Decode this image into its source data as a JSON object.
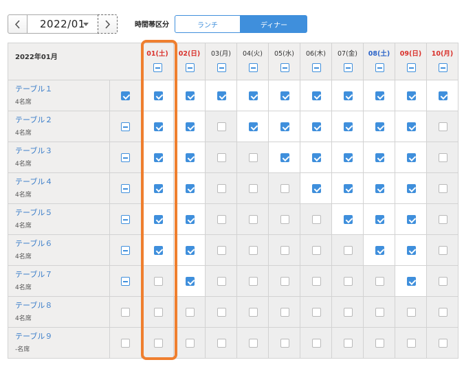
{
  "toolbar": {
    "month": "2022/01",
    "timezone_label": "時間帯区分",
    "segments": [
      "ランチ",
      "ディナー"
    ],
    "selected_segment": "ディナー"
  },
  "grid_header": "2022年01月",
  "dates": [
    {
      "label": "01(土)",
      "kind": "hol",
      "bold": true
    },
    {
      "label": "02(日)",
      "kind": "sun",
      "bold": true
    },
    {
      "label": "03(月)",
      "kind": "normal",
      "bold": false
    },
    {
      "label": "04(火)",
      "kind": "normal",
      "bold": false
    },
    {
      "label": "05(水)",
      "kind": "normal",
      "bold": false
    },
    {
      "label": "06(木)",
      "kind": "normal",
      "bold": false
    },
    {
      "label": "07(金)",
      "kind": "normal",
      "bold": false
    },
    {
      "label": "08(土)",
      "kind": "sat",
      "bold": true
    },
    {
      "label": "09(日)",
      "kind": "sun",
      "bold": true
    },
    {
      "label": "10(月)",
      "kind": "hol",
      "bold": true
    }
  ],
  "tables": [
    {
      "name": "テーブル１",
      "capacity": "4名席",
      "row_state": "on",
      "days": [
        1,
        1,
        1,
        1,
        1,
        1,
        1,
        1,
        1,
        1
      ]
    },
    {
      "name": "テーブル２",
      "capacity": "4名席",
      "row_state": "mixed",
      "days": [
        1,
        1,
        0,
        1,
        1,
        1,
        1,
        1,
        1,
        0
      ]
    },
    {
      "name": "テーブル３",
      "capacity": "4名席",
      "row_state": "mixed",
      "days": [
        1,
        1,
        0,
        0,
        1,
        1,
        1,
        1,
        1,
        0
      ]
    },
    {
      "name": "テーブル４",
      "capacity": "4名席",
      "row_state": "mixed",
      "days": [
        1,
        1,
        0,
        0,
        0,
        1,
        1,
        1,
        1,
        0
      ]
    },
    {
      "name": "テーブル５",
      "capacity": "4名席",
      "row_state": "mixed",
      "days": [
        1,
        1,
        0,
        0,
        0,
        0,
        1,
        1,
        1,
        0
      ]
    },
    {
      "name": "テーブル６",
      "capacity": "4名席",
      "row_state": "mixed",
      "days": [
        1,
        1,
        0,
        0,
        0,
        0,
        0,
        1,
        1,
        0
      ]
    },
    {
      "name": "テーブル７",
      "capacity": "4名席",
      "row_state": "mixed",
      "days": [
        0,
        1,
        0,
        0,
        0,
        0,
        0,
        0,
        1,
        0
      ]
    },
    {
      "name": "テーブル８",
      "capacity": "4名席",
      "row_state": "off",
      "days": [
        0,
        0,
        0,
        0,
        0,
        0,
        0,
        0,
        0,
        0
      ]
    },
    {
      "name": "テーブル９",
      "capacity": "-名席",
      "row_state": "off",
      "days": [
        0,
        0,
        0,
        0,
        0,
        0,
        0,
        0,
        0,
        0
      ]
    }
  ],
  "colors": {
    "accent": "#3f8fdc",
    "highlight": "#ef7f2f",
    "saturday": "#2a63c8",
    "holiday": "#d9312b"
  }
}
